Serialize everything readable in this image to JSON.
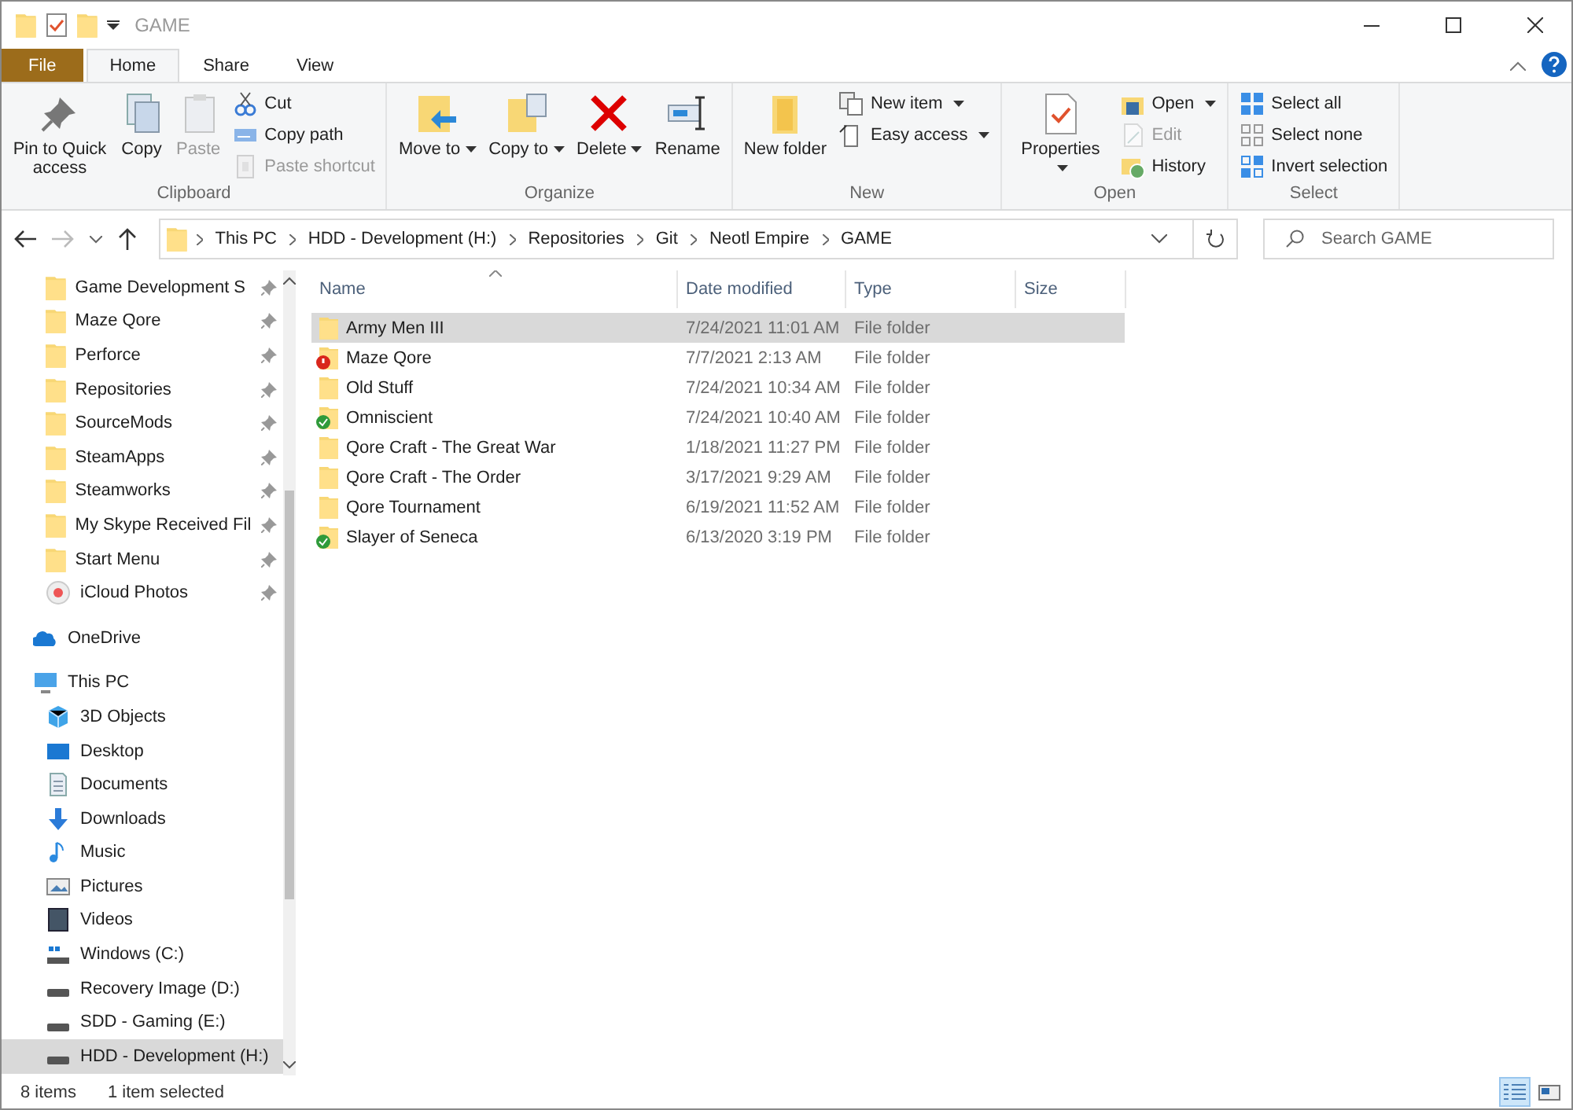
{
  "window": {
    "title": "GAME"
  },
  "ribbon_tabs": [
    {
      "label": "File",
      "kind": "file",
      "selected": false
    },
    {
      "label": "Home",
      "kind": "tab",
      "selected": true
    },
    {
      "label": "Share",
      "kind": "tab",
      "selected": false
    },
    {
      "label": "View",
      "kind": "tab",
      "selected": false
    }
  ],
  "ribbon_groups": [
    {
      "label": "Clipboard",
      "large": [
        {
          "label": "Pin to Quick access",
          "kind": "pin",
          "disabled": false
        },
        {
          "label": "Copy",
          "kind": "copy",
          "disabled": false
        },
        {
          "label": "Paste",
          "kind": "paste",
          "disabled": true
        }
      ],
      "small": [
        {
          "label": "Cut",
          "kind": "cut",
          "disabled": false,
          "dropdown": false
        },
        {
          "label": "Copy path",
          "kind": "copypath",
          "disabled": false,
          "dropdown": false
        },
        {
          "label": "Paste shortcut",
          "kind": "pasteshortcut",
          "disabled": true,
          "dropdown": false
        }
      ]
    },
    {
      "label": "Organize",
      "large": [
        {
          "label": "Move to",
          "kind": "move",
          "disabled": false,
          "dropdown": true
        },
        {
          "label": "Copy to",
          "kind": "copyto",
          "disabled": false,
          "dropdown": true
        },
        {
          "label": "Delete",
          "kind": "delete",
          "disabled": false,
          "dropdown": true
        },
        {
          "label": "Rename",
          "kind": "rename",
          "disabled": false
        }
      ]
    },
    {
      "label": "New",
      "large": [
        {
          "label": "New folder",
          "kind": "newfolder",
          "disabled": false
        }
      ],
      "small": [
        {
          "label": "New item",
          "kind": "newitem",
          "disabled": false,
          "dropdown": true
        },
        {
          "label": "Easy access",
          "kind": "easyaccess",
          "disabled": false,
          "dropdown": true
        }
      ]
    },
    {
      "label": "Open",
      "large": [
        {
          "label": "Properties",
          "kind": "properties",
          "disabled": false,
          "dropdown": true
        }
      ],
      "small": [
        {
          "label": "Open",
          "kind": "open",
          "disabled": false,
          "dropdown": true
        },
        {
          "label": "Edit",
          "kind": "edit",
          "disabled": true,
          "dropdown": false
        },
        {
          "label": "History",
          "kind": "history",
          "disabled": false,
          "dropdown": false
        }
      ]
    },
    {
      "label": "Select",
      "small": [
        {
          "label": "Select all",
          "kind": "selectall",
          "disabled": false,
          "dropdown": false
        },
        {
          "label": "Select none",
          "kind": "selectnone",
          "disabled": false,
          "dropdown": false
        },
        {
          "label": "Invert selection",
          "kind": "invert",
          "disabled": false,
          "dropdown": false
        }
      ]
    }
  ],
  "address": {
    "crumbs": [
      "This PC",
      "HDD - Development (H:)",
      "Repositories",
      "Git",
      "Neotl Empire",
      "GAME"
    ]
  },
  "search": {
    "placeholder": "Search GAME"
  },
  "sidebar": {
    "pinned": [
      {
        "label": "Game Development S",
        "kind": "folder",
        "selected": false
      },
      {
        "label": "Maze Qore",
        "kind": "folder",
        "selected": false
      },
      {
        "label": "Perforce",
        "kind": "folder",
        "selected": false
      },
      {
        "label": "Repositories",
        "kind": "folder",
        "selected": false
      },
      {
        "label": "SourceMods",
        "kind": "folder",
        "selected": false
      },
      {
        "label": "SteamApps",
        "kind": "folder",
        "selected": false
      },
      {
        "label": "Steamworks",
        "kind": "folder",
        "selected": false
      },
      {
        "label": "My Skype Received Fil",
        "kind": "folder",
        "selected": false
      },
      {
        "label": "Start Menu",
        "kind": "folder",
        "selected": false
      },
      {
        "label": "iCloud Photos",
        "kind": "icloud",
        "selected": false
      }
    ],
    "locations": [
      {
        "label": "OneDrive",
        "kind": "onedrive",
        "selected": false
      },
      {
        "label": "This PC",
        "kind": "pc",
        "selected": false,
        "children": [
          {
            "label": "3D Objects",
            "kind": "objects",
            "selected": false
          },
          {
            "label": "Desktop",
            "kind": "desktop",
            "selected": false
          },
          {
            "label": "Documents",
            "kind": "documents",
            "selected": false
          },
          {
            "label": "Downloads",
            "kind": "downloads",
            "selected": false
          },
          {
            "label": "Music",
            "kind": "music",
            "selected": false
          },
          {
            "label": "Pictures",
            "kind": "pictures",
            "selected": false
          },
          {
            "label": "Videos",
            "kind": "videos",
            "selected": false
          },
          {
            "label": "Windows (C:)",
            "kind": "windrive",
            "selected": false
          },
          {
            "label": "Recovery Image (D:)",
            "kind": "drive",
            "selected": false
          },
          {
            "label": "SDD - Gaming (E:)",
            "kind": "drive",
            "selected": false
          },
          {
            "label": "HDD - Development (H:)",
            "kind": "drive",
            "selected": true
          }
        ]
      }
    ]
  },
  "table": {
    "columns": [
      {
        "label": "Name",
        "sorted": true
      },
      {
        "label": "Date modified",
        "sorted": false
      },
      {
        "label": "Type",
        "sorted": false
      },
      {
        "label": "Size",
        "sorted": false
      }
    ],
    "rows": [
      {
        "name": "Army Men III",
        "date": "7/24/2021 11:01 AM",
        "type": "File folder",
        "kind": "plain",
        "selected": true
      },
      {
        "name": "Maze Qore",
        "date": "7/7/2021 2:13 AM",
        "type": "File folder",
        "kind": "error",
        "selected": false
      },
      {
        "name": "Old Stuff",
        "date": "7/24/2021 10:34 AM",
        "type": "File folder",
        "kind": "plain",
        "selected": false
      },
      {
        "name": "Omniscient",
        "date": "7/24/2021 10:40 AM",
        "type": "File folder",
        "kind": "synced",
        "selected": false
      },
      {
        "name": "Qore Craft - The Great War",
        "date": "1/18/2021 11:27 PM",
        "type": "File folder",
        "kind": "plain",
        "selected": false
      },
      {
        "name": "Qore Craft - The Order",
        "date": "3/17/2021 9:29 AM",
        "type": "File folder",
        "kind": "plain",
        "selected": false
      },
      {
        "name": "Qore Tournament",
        "date": "6/19/2021 11:52 AM",
        "type": "File folder",
        "kind": "plain",
        "selected": false
      },
      {
        "name": "Slayer of Seneca",
        "date": "6/13/2020 3:19 PM",
        "type": "File folder",
        "kind": "synced",
        "selected": false
      }
    ]
  },
  "status_bar": {
    "count": "8 items",
    "selection": "1 item selected",
    "views": [
      {
        "kind": "details",
        "selected": true
      },
      {
        "kind": "tiles",
        "selected": false
      }
    ]
  }
}
